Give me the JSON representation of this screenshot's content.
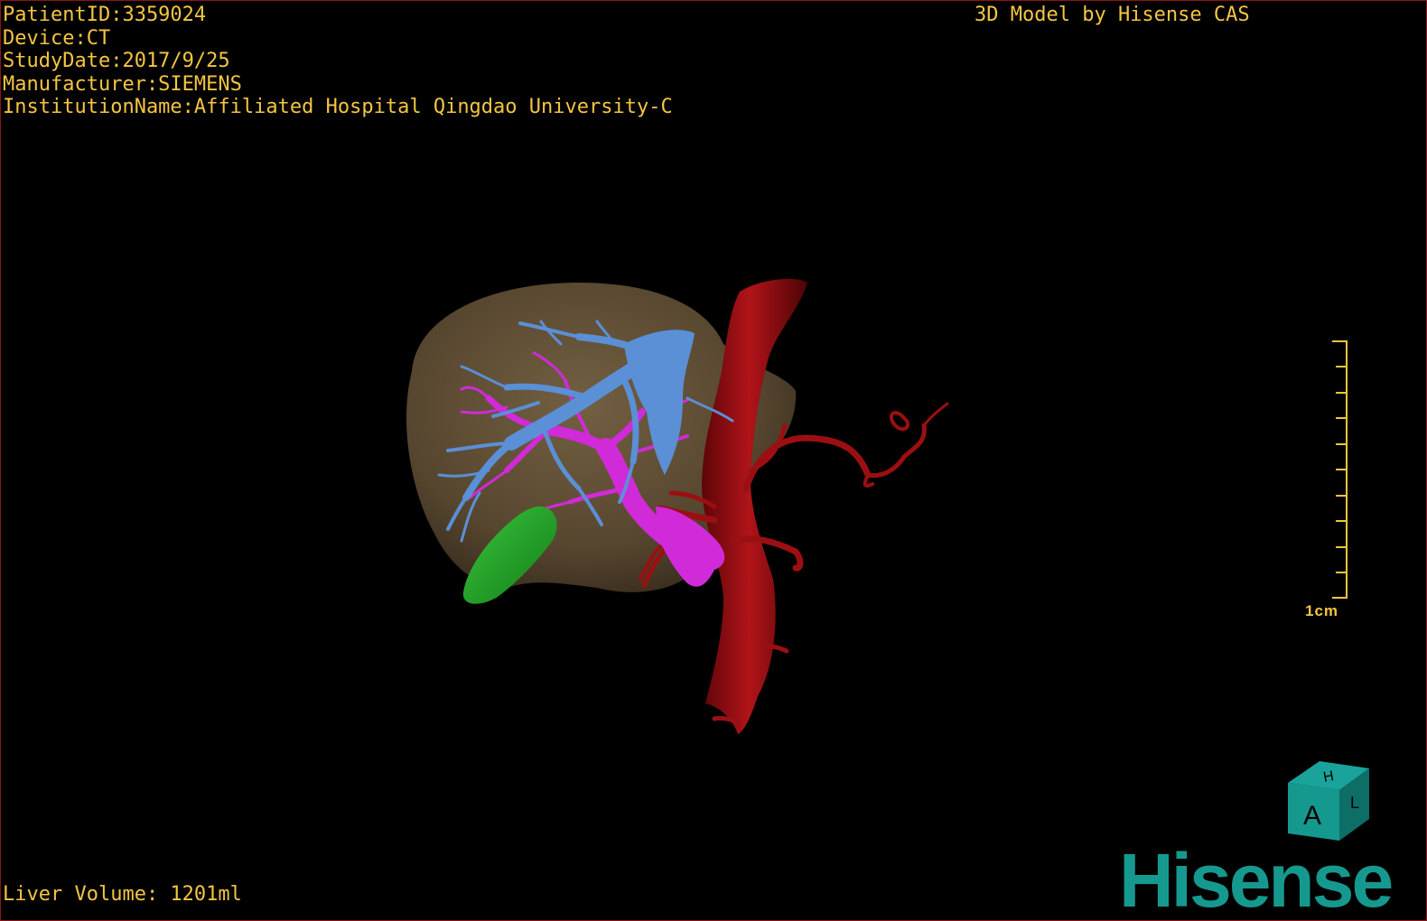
{
  "overlay": {
    "patient_id": "PatientID:3359024",
    "device": "Device:CT",
    "study_date": "StudyDate:2017/9/25",
    "manufacturer": "Manufacturer:SIEMENS",
    "institution": "InstitutionName:Affiliated Hospital Qingdao University-C",
    "credit": "3D Model by Hisense CAS",
    "liver_volume": "Liver Volume: 1201ml"
  },
  "scale_bar": {
    "label": "1cm"
  },
  "orientation_cube": {
    "front_face": "A",
    "top_face": "H",
    "right_face": "L"
  },
  "brand": {
    "logo_text": "Hisense"
  },
  "colors": {
    "overlay_text": "#f4c542",
    "liver": "#6e5a3f",
    "hepatic_vein": "#5b8fd6",
    "portal_vein": "#d12ad8",
    "artery": "#9b0f12",
    "gallbladder": "#22a82a",
    "brand": "#15998f"
  }
}
